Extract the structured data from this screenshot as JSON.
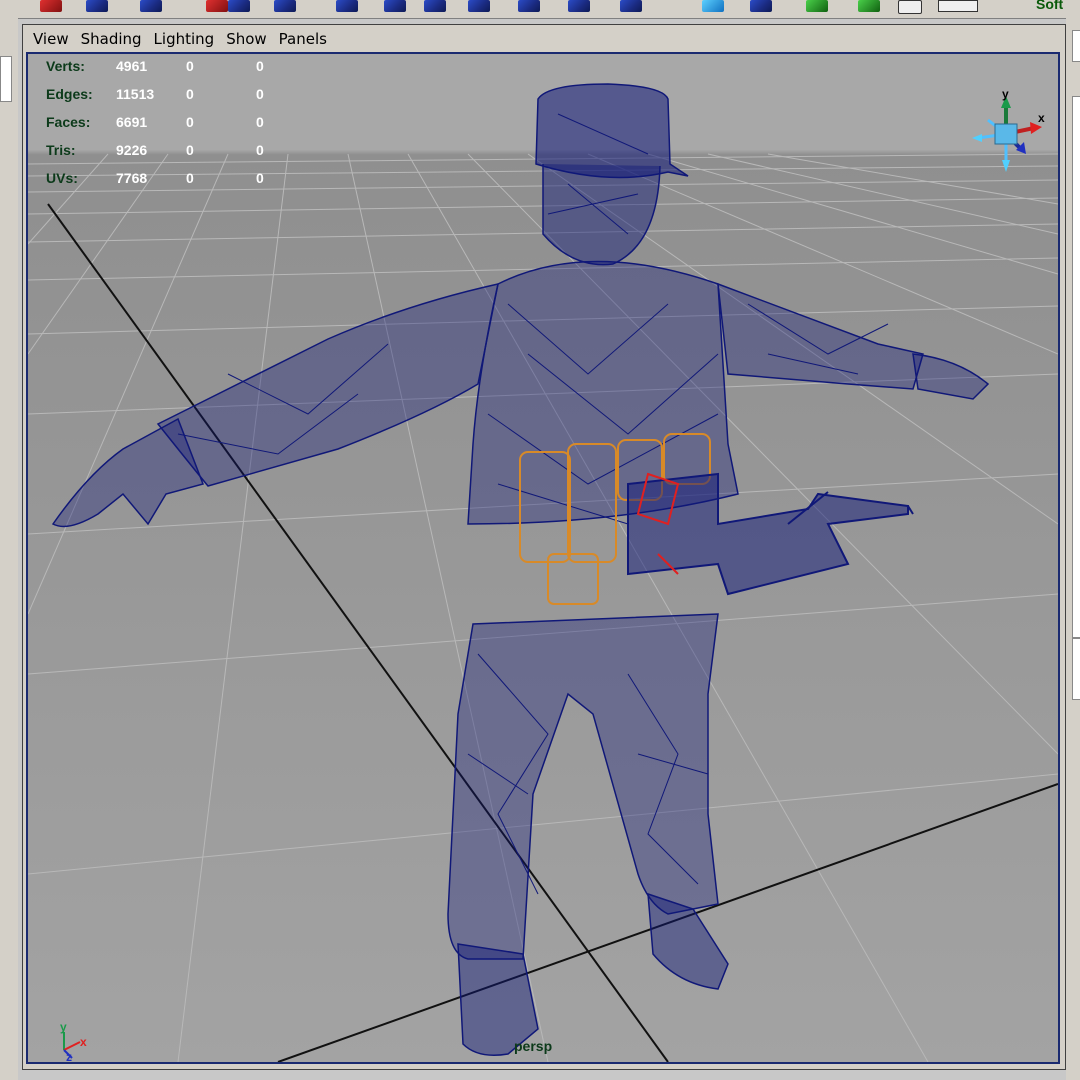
{
  "menu": {
    "view": "View",
    "shading": "Shading",
    "lighting": "Lighting",
    "show": "Show",
    "panels": "Panels"
  },
  "hud": {
    "rows": [
      {
        "label": "Verts:",
        "c1": "4961",
        "c2": "0",
        "c3": "0"
      },
      {
        "label": "Edges:",
        "c1": "11513",
        "c2": "0",
        "c3": "0"
      },
      {
        "label": "Faces:",
        "c1": "6691",
        "c2": "0",
        "c3": "0"
      },
      {
        "label": "Tris:",
        "c1": "9226",
        "c2": "0",
        "c3": "0"
      },
      {
        "label": "UVs:",
        "c1": "7768",
        "c2": "0",
        "c3": "0"
      }
    ]
  },
  "camera": {
    "name": "persp"
  },
  "toolbar": {
    "right_text": "Soft"
  },
  "view_cube": {
    "x": "x",
    "y": "y"
  },
  "origin_axis": {
    "x": "x",
    "y": "y",
    "z": "z"
  },
  "colors": {
    "viewport_background": "#a0a0a0",
    "wireframe": "#101878",
    "selected_wireframe": "#d88a28",
    "hud_label": "#0c3a1a",
    "hud_value": "#ffffff"
  },
  "icons": [
    "move-tool-icon",
    "rotate-tool-icon",
    "scale-tool-icon",
    "render-icon"
  ]
}
